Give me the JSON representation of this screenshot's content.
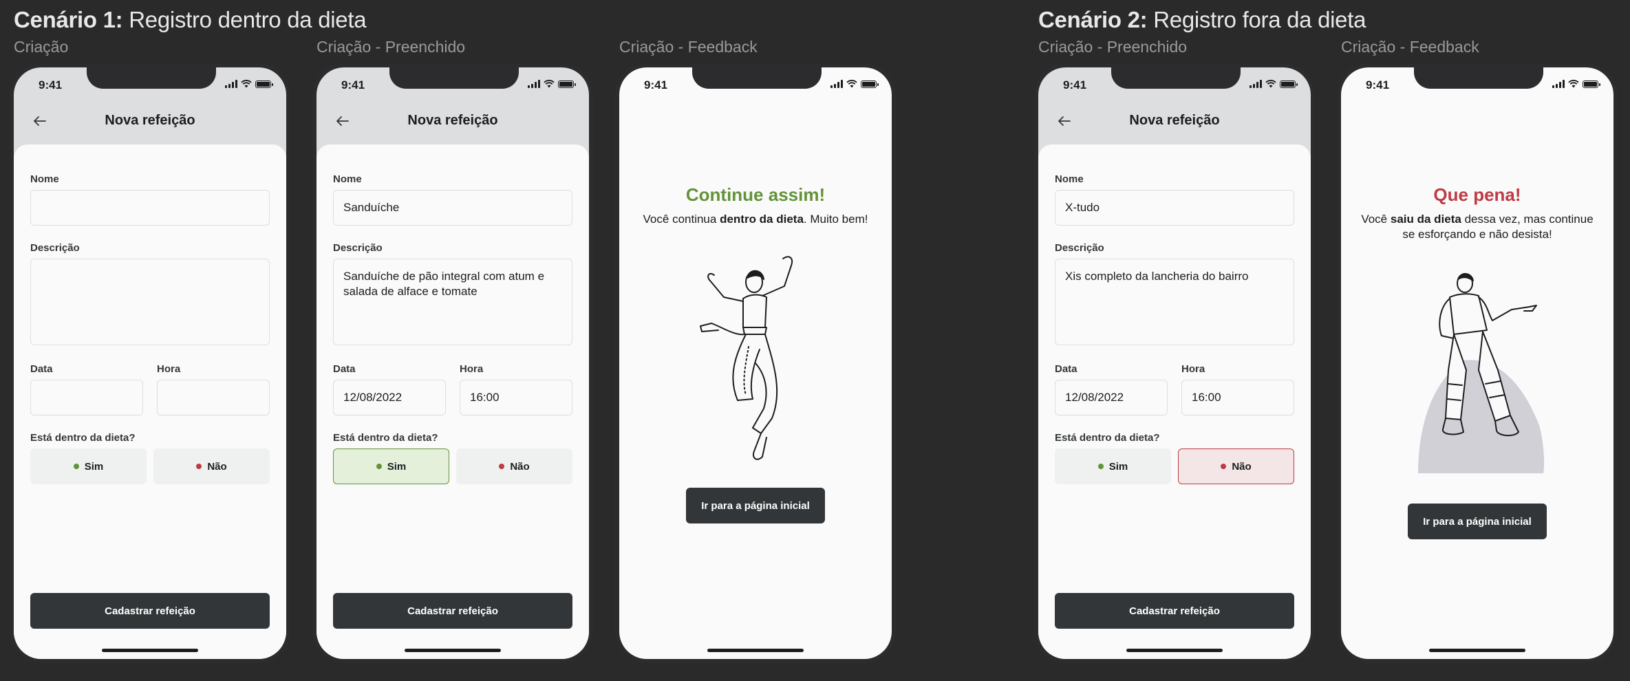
{
  "scenario1": {
    "bold": "Cenário 1:",
    "rest": " Registro dentro da dieta"
  },
  "scenario2": {
    "bold": "Cenário 2:",
    "rest": " Registro fora da dieta"
  },
  "labels": {
    "f1": "Criação",
    "f2": "Criação - Preenchido",
    "f3": "Criação - Feedback",
    "f4": "Criação - Preenchido",
    "f5": "Criação - Feedback"
  },
  "status": {
    "time": "9:41"
  },
  "form": {
    "header_title": "Nova refeição",
    "name_label": "Nome",
    "desc_label": "Descrição",
    "date_label": "Data",
    "hour_label": "Hora",
    "diet_question": "Está dentro da dieta?",
    "yes": "Sim",
    "no": "Não",
    "submit": "Cadastrar refeição"
  },
  "filled1": {
    "name": "Sanduíche",
    "desc": "Sanduíche de pão integral com atum e salada de alface e tomate",
    "date": "12/08/2022",
    "hour": "16:00"
  },
  "filled2": {
    "name": "X-tudo",
    "desc": "Xis completo da lancheria do bairro",
    "date": "12/08/2022",
    "hour": "16:00"
  },
  "feedback_ok": {
    "title": "Continue assim!",
    "pre": "Você continua ",
    "bold": "dentro da dieta",
    "post": ". Muito bem!",
    "button": "Ir para a página inicial"
  },
  "feedback_bad": {
    "title": "Que pena!",
    "pre": "Você ",
    "bold": "saiu da dieta",
    "post": " dessa vez, mas continue se esforçando e não desista!",
    "button": "Ir para a página inicial"
  },
  "colors": {
    "green": "#639339",
    "red": "#bf3b44",
    "dark": "#333638"
  },
  "icons": [
    "arrow-left-icon",
    "signal-icon",
    "wifi-icon",
    "battery-icon"
  ]
}
